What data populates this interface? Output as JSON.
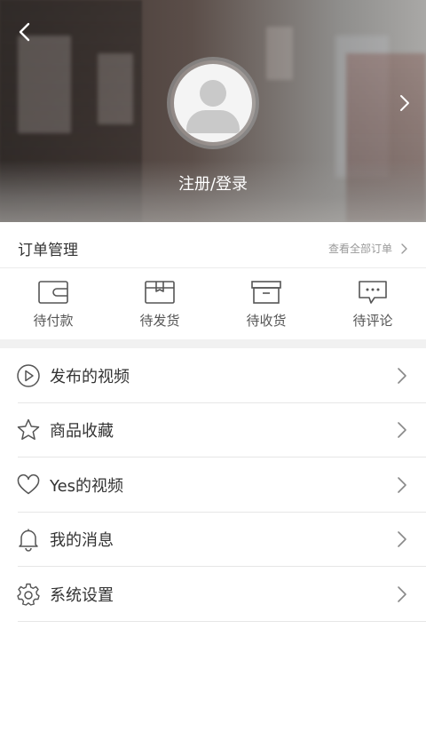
{
  "header": {
    "login_label": "注册/登录"
  },
  "orders": {
    "title": "订单管理",
    "view_all_label": "查看全部订单",
    "tabs": [
      {
        "label": "待付款",
        "icon": "wallet-icon"
      },
      {
        "label": "待发货",
        "icon": "package-icon"
      },
      {
        "label": "待收货",
        "icon": "archive-box-icon"
      },
      {
        "label": "待评论",
        "icon": "comment-icon"
      }
    ]
  },
  "menu": {
    "items": [
      {
        "label": "发布的视频",
        "icon": "play-circle-icon"
      },
      {
        "label": "商品收藏",
        "icon": "star-icon"
      },
      {
        "label": "Yes的视频",
        "icon": "heart-icon"
      },
      {
        "label": "我的消息",
        "icon": "bell-icon"
      },
      {
        "label": "系统设置",
        "icon": "gear-icon"
      }
    ]
  },
  "colors": {
    "icon_stroke": "#555555",
    "divider": "#f1f1f1",
    "muted_text": "#999999"
  }
}
